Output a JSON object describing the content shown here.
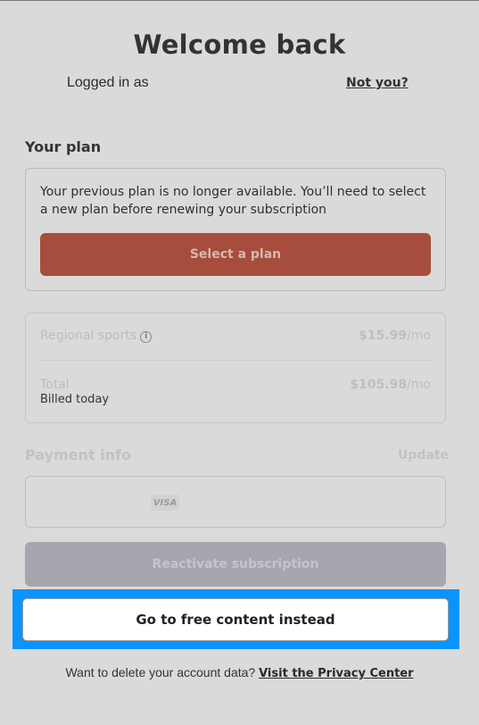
{
  "header": {
    "title": "Welcome back",
    "logged_in_label": "Logged in as",
    "not_you_link": "Not you?"
  },
  "plan": {
    "section_title": "Your plan",
    "message": "Your previous plan is no longer available. You’ll need to select a new plan before renewing your subscription",
    "select_button": "Select a plan"
  },
  "summary": {
    "regional_label": "Regional sports",
    "regional_price": "$15.99",
    "regional_period": "/mo",
    "total_label": "Total",
    "total_price": "$105.98",
    "total_period": "/mo",
    "billed_label": "Billed today",
    "info_icon": "info-icon"
  },
  "payment": {
    "section_title": "Payment info",
    "update_link": "Update",
    "card_brand": "VISA"
  },
  "actions": {
    "reactivate_button": "Reactivate subscription",
    "free_content_button": "Go to free content instead"
  },
  "footer": {
    "text": "Want to delete your account data?",
    "privacy_link": "Visit the Privacy Center"
  },
  "colors": {
    "background": "#dadada",
    "select_button": "#a64d3e",
    "reactivate_button": "#a6a6ae",
    "highlight": "#0a94ff"
  }
}
